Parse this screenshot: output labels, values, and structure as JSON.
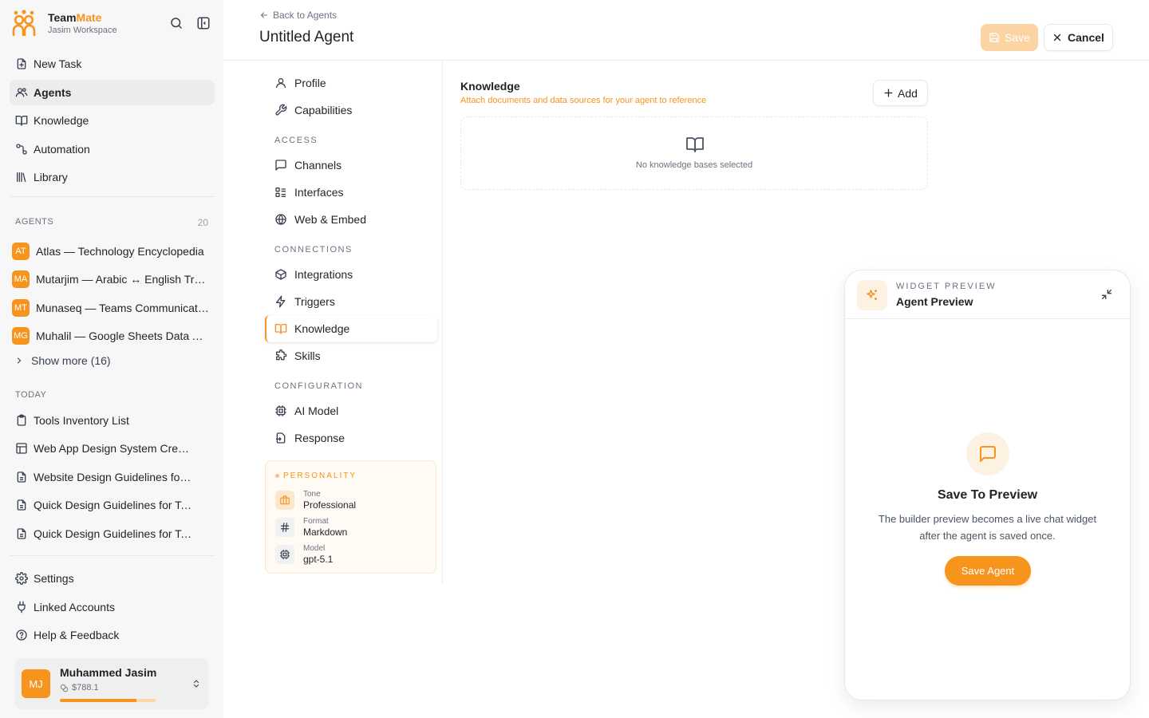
{
  "brand": {
    "name_part1": "Team",
    "name_part2": "Mate",
    "workspace": "Jasim Workspace"
  },
  "nav": [
    {
      "label": "New Task",
      "icon": "new-task-icon"
    },
    {
      "label": "Agents",
      "icon": "agents-icon",
      "active": true
    },
    {
      "label": "Knowledge",
      "icon": "book-icon"
    },
    {
      "label": "Automation",
      "icon": "automation-icon"
    },
    {
      "label": "Library",
      "icon": "library-icon"
    }
  ],
  "agents_section": {
    "label": "AGENTS",
    "count": "20",
    "items": [
      {
        "initials": "AT",
        "name": "Atlas — Technology Encyclopedia"
      },
      {
        "initials": "MA",
        "name": "Mutarjim — Arabic ↔ English Translator"
      },
      {
        "initials": "MT",
        "name": "Munaseq — Teams Communication Assistant"
      },
      {
        "initials": "MG",
        "name": "Muhalil — Google Sheets Data Analyst"
      }
    ],
    "show_more": "Show more (16)"
  },
  "history": {
    "label": "TODAY",
    "items": [
      {
        "label": "Tools Inventory List",
        "icon": "clipboard-icon"
      },
      {
        "label": "Web App Design System Creation",
        "icon": "layout-icon"
      },
      {
        "label": "Website Design Guidelines for Teams",
        "icon": "document-icon"
      },
      {
        "label": "Quick Design Guidelines for Tasks",
        "icon": "document-icon"
      },
      {
        "label": "Quick Design Guidelines for Tasks",
        "icon": "document-icon"
      }
    ]
  },
  "bottom_nav": [
    {
      "label": "Settings",
      "icon": "gear-icon"
    },
    {
      "label": "Linked Accounts",
      "icon": "plug-icon"
    },
    {
      "label": "Help & Feedback",
      "icon": "help-icon"
    }
  ],
  "user": {
    "initials": "MJ",
    "name": "Muhammed Jasim",
    "credit": "$788.1",
    "credit_fraction": 0.8
  },
  "header": {
    "back_label": "Back to Agents",
    "title": "Untitled Agent",
    "save_label": "Save",
    "cancel_label": "Cancel"
  },
  "settings_nav": {
    "top": [
      {
        "label": "Profile",
        "icon": "user-icon"
      },
      {
        "label": "Capabilities",
        "icon": "wrench-icon"
      }
    ],
    "access_label": "ACCESS",
    "access": [
      {
        "label": "Channels",
        "icon": "message-square-icon"
      },
      {
        "label": "Interfaces",
        "icon": "list-icon"
      },
      {
        "label": "Web & Embed",
        "icon": "globe-icon"
      }
    ],
    "connections_label": "CONNECTIONS",
    "connections": [
      {
        "label": "Integrations",
        "icon": "box-icon"
      },
      {
        "label": "Triggers",
        "icon": "zap-icon"
      },
      {
        "label": "Knowledge",
        "icon": "book-icon",
        "active": true
      },
      {
        "label": "Skills",
        "icon": "puzzle-icon"
      }
    ],
    "configuration_label": "CONFIGURATION",
    "configuration": [
      {
        "label": "AI Model",
        "icon": "cpu-icon"
      },
      {
        "label": "Response",
        "icon": "response-icon"
      }
    ]
  },
  "personality": {
    "title": "PERSONALITY",
    "tone_label": "Tone",
    "tone_value": "Professional",
    "format_label": "Format",
    "format_value": "Markdown",
    "model_label": "Model",
    "model_value": "gpt-5.1"
  },
  "knowledge": {
    "title": "Knowledge",
    "subtitle": "Attach documents and data sources for your agent to reference",
    "add_label": "Add",
    "empty_text": "No knowledge bases selected"
  },
  "widget": {
    "kicker": "WIDGET PREVIEW",
    "title": "Agent Preview",
    "body_title": "Save To Preview",
    "body_desc": "The builder preview becomes a live chat widget after the agent is saved once.",
    "button_label": "Save Agent"
  },
  "colors": {
    "accent": "#f7941d",
    "accent_light": "#fcd3a3",
    "sidebar_bg": "#f7f7f7"
  }
}
